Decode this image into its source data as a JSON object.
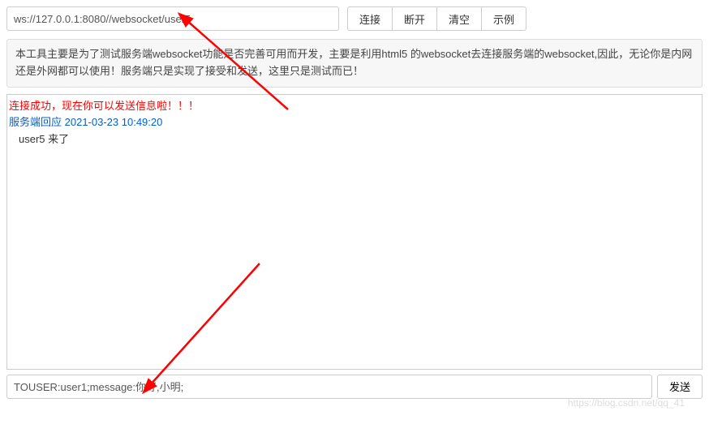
{
  "header": {
    "url_value": "ws://127.0.0.1:8080//websocket/user5",
    "buttons": {
      "connect": "连接",
      "disconnect": "断开",
      "clear": "清空",
      "example": "示例"
    }
  },
  "info_text": "本工具主要是为了测试服务端websocket功能是否完善可用而开发，主要是利用html5 的websocket去连接服务端的websocket,因此，无论你是内网还是外网都可以使用！服务端只是实现了接受和发送，这里只是测试而已！",
  "log": {
    "connected": "连接成功，现在你可以发送信息啦！！！",
    "server_reply_label": "服务端回应",
    "timestamp": "2021-03-23 10:49:20",
    "message": "user5 来了"
  },
  "footer": {
    "msg_value": "TOUSER:user1;message:你好,小明;",
    "send_label": "发送"
  },
  "watermark": "https://blog.csdn.net/qq_41"
}
